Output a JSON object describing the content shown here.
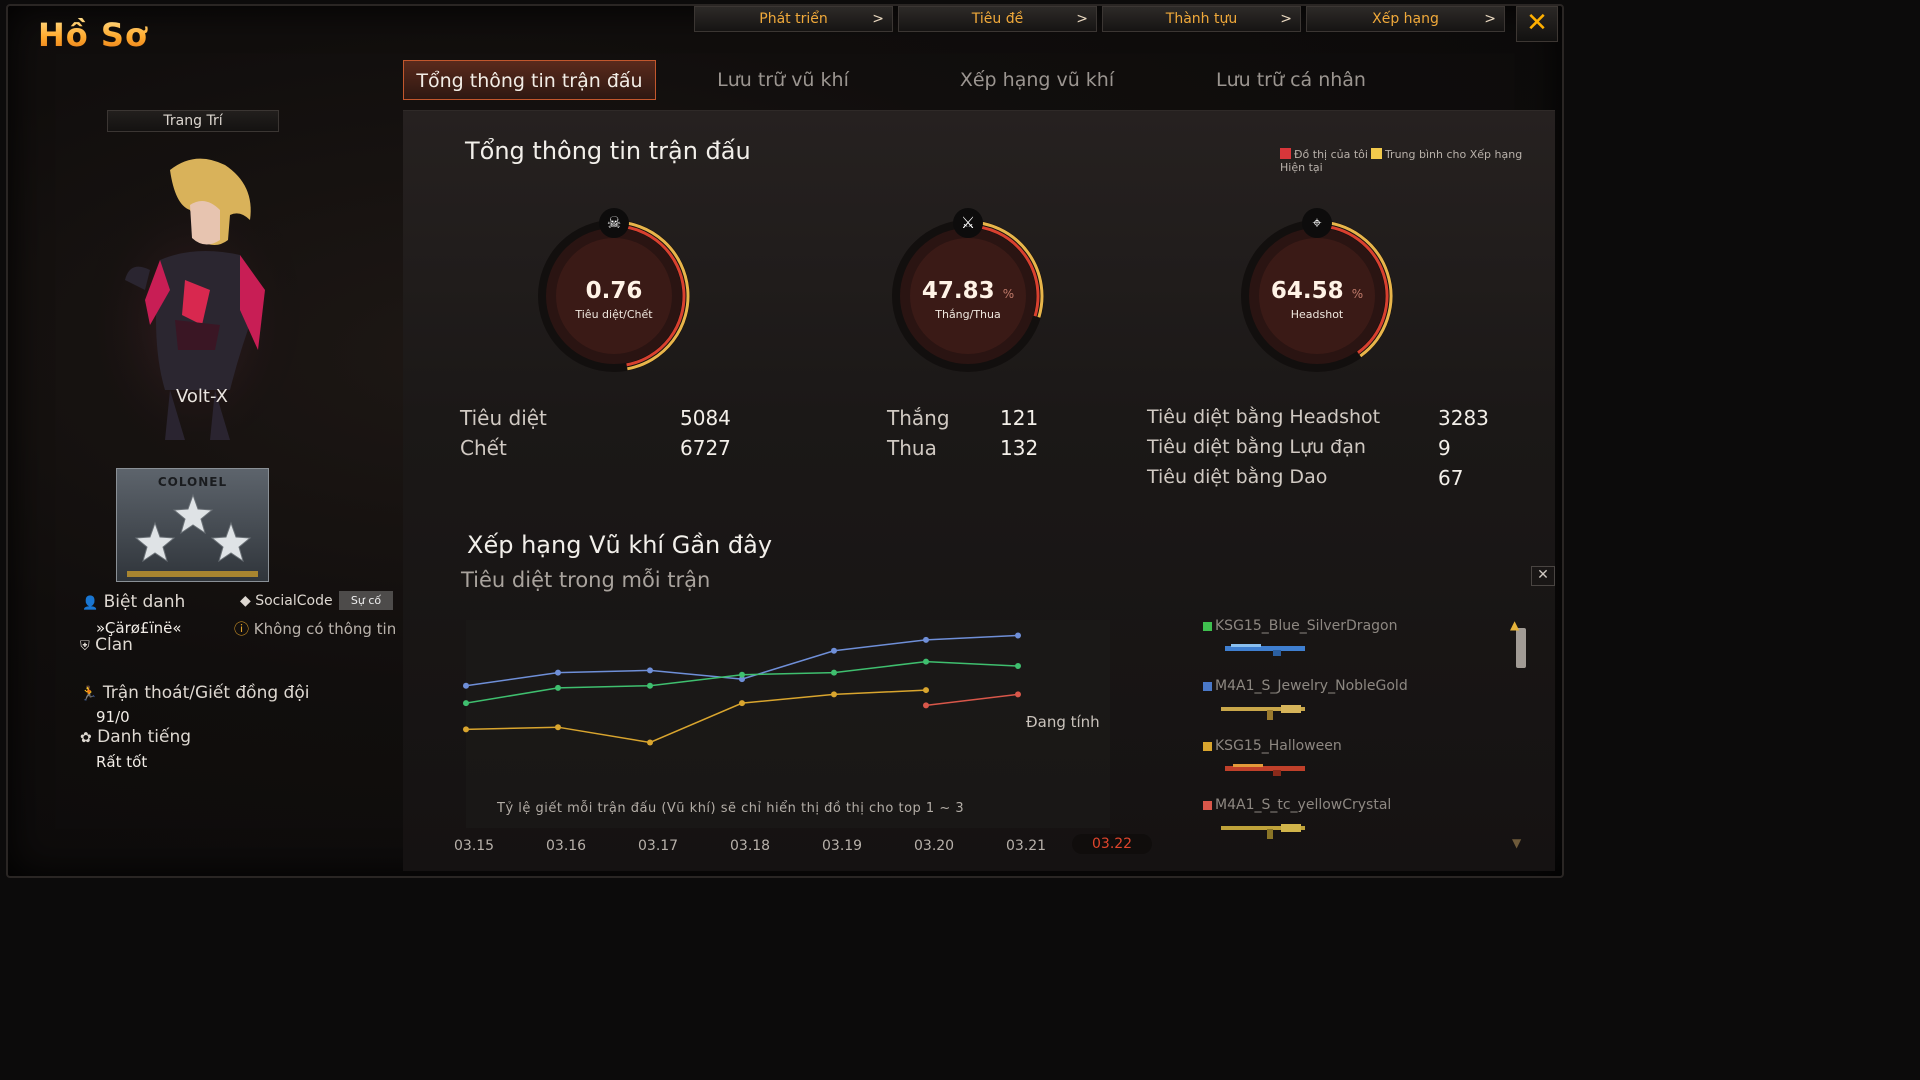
{
  "title": "Hồ Sơ",
  "top_nav": [
    {
      "label": "Phát triển"
    },
    {
      "label": "Tiêu đề"
    },
    {
      "label": "Thành tựu"
    },
    {
      "label": "Xếp hạng"
    }
  ],
  "tabs": [
    {
      "label": "Tổng thông tin trận đấu",
      "active": true
    },
    {
      "label": "Lưu trữ vũ khí"
    },
    {
      "label": "Xếp hạng vũ khí"
    },
    {
      "label": "Lưu trữ cá nhân"
    }
  ],
  "profile": {
    "decorate_button": "Trang Trí",
    "character_name": "Volt-X",
    "rank_title": "COLONEL",
    "nickname_label": "Biệt danh",
    "nickname_value": "»Çärø£ïnë«",
    "socialcode_label": "SocialCode",
    "socialcode_badge": "Sự cố",
    "socialcode_value": "Không có thông tin",
    "clan_label": "Clan",
    "desertion_label": "Trận thoát/Giết đồng đội",
    "desertion_value": "91/0",
    "reputation_label": "Danh tiếng",
    "reputation_value": "Rất tốt"
  },
  "summary": {
    "title": "Tổng thông tin trận đấu",
    "legend_mine": "Đồ thị của tôi",
    "legend_avg": "Trung bình cho Xếp hạng Hiện tại",
    "legend_mine_color": "#d8363a",
    "legend_avg_color": "#f2c94c",
    "gauges": [
      {
        "value": "0.76",
        "unit": "",
        "label": "Tiêu diệt/Chết",
        "icon": "skull-icon",
        "fraction": 0.76
      },
      {
        "value": "47.83",
        "unit": "%",
        "label": "Thắng/Thua",
        "icon": "crossed-swords-icon",
        "fraction": 0.4783
      },
      {
        "value": "64.58",
        "unit": "%",
        "label": "Headshot",
        "icon": "crosshair-icon",
        "fraction": 0.6458
      }
    ],
    "kills_label": "Tiêu diệt",
    "kills": "5084",
    "deaths_label": "Chết",
    "deaths": "6727",
    "wins_label": "Thắng",
    "wins": "121",
    "losses_label": "Thua",
    "losses": "132",
    "hs_label": "Tiêu diệt bằng Headshot",
    "hs": "3283",
    "grenade_label": "Tiêu diệt bằng Lựu đạn",
    "grenade": "9",
    "knife_label": "Tiêu diệt bằng Dao",
    "knife": "67"
  },
  "weapon_ranking": {
    "title": "Xếp hạng Vũ khí Gần đây",
    "subtitle": "Tiêu diệt trong mỗi trận",
    "counting": "Đang tính",
    "note": "Tỷ lệ giết mỗi trận đấu (Vũ khí) sẽ chỉ hiển thị đồ thị cho top 1 ~ 3",
    "weapons": [
      {
        "name": "KSG15_Blue_SilverDragon",
        "color": "#3fbf4f"
      },
      {
        "name": "M4A1_S_Jewelry_NobleGold",
        "color": "#4a78c8"
      },
      {
        "name": "KSG15_Halloween",
        "color": "#d9a52e"
      },
      {
        "name": "M4A1_S_tc_yellowCrystal",
        "color": "#d9574a"
      }
    ]
  },
  "chart_data": {
    "type": "line",
    "x": [
      "03.15",
      "03.16",
      "03.17",
      "03.18",
      "03.19",
      "03.20",
      "03.21",
      "03.22"
    ],
    "selected": "03.22",
    "ylim": [
      0,
      10
    ],
    "series": [
      {
        "name": "KSG15_Blue_SilverDragon",
        "color": "#6f8fd8",
        "values": [
          5.6,
          6.2,
          6.3,
          5.9,
          7.2,
          7.7,
          7.9,
          null
        ]
      },
      {
        "name": "M4A1_S_Jewelry_NobleGold",
        "color": "#3fbf6f",
        "values": [
          4.8,
          5.5,
          5.6,
          6.1,
          6.2,
          6.7,
          6.5,
          null
        ]
      },
      {
        "name": "KSG15_Halloween",
        "color": "#d9a52e",
        "values": [
          3.6,
          3.7,
          3.0,
          4.8,
          5.2,
          5.4,
          null,
          null
        ]
      },
      {
        "name": "M4A1_S_tc_yellowCrystal",
        "color": "#d9574a",
        "values": [
          null,
          null,
          null,
          null,
          null,
          4.7,
          5.2,
          null
        ]
      }
    ]
  }
}
